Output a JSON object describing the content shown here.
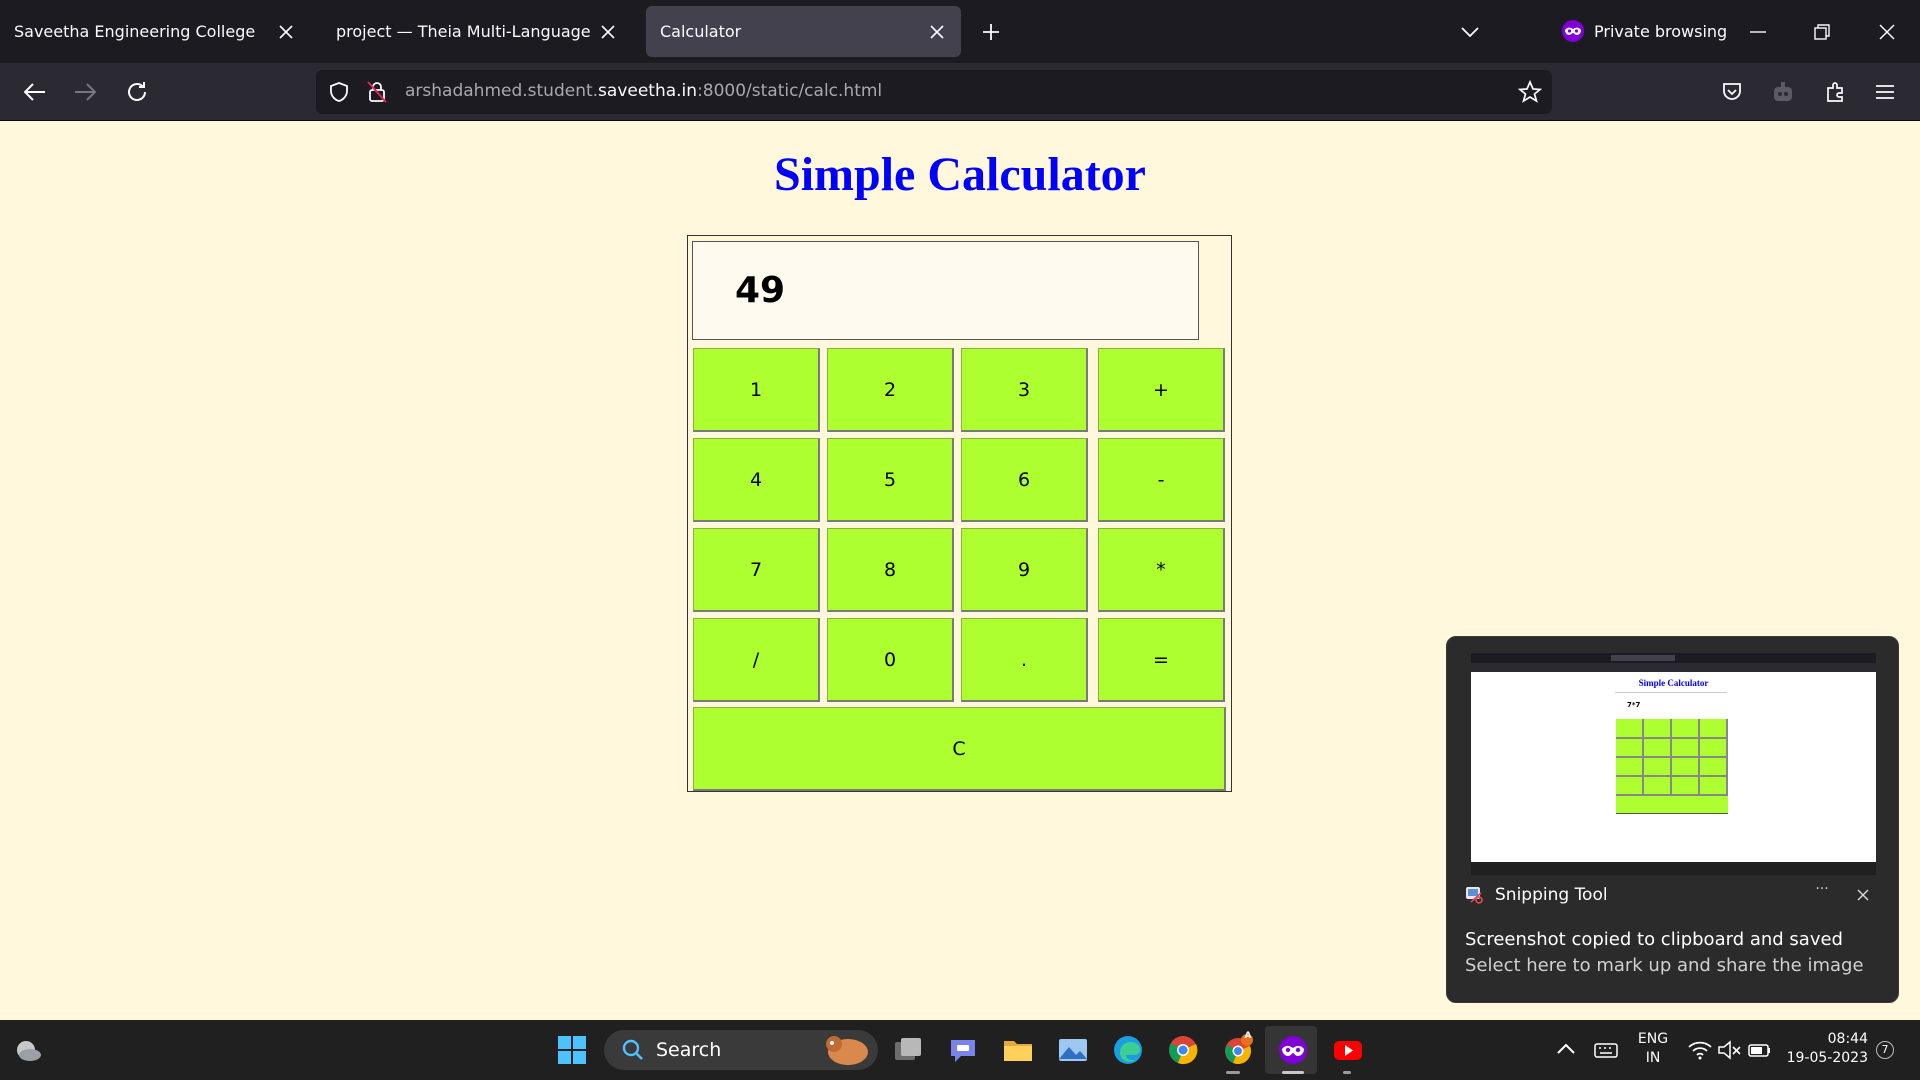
{
  "browser": {
    "tabs": [
      {
        "label": "Saveetha Engineering College",
        "active": false
      },
      {
        "label": "project — Theia Multi-Language Example",
        "active": false
      },
      {
        "label": "Calculator",
        "active": true
      }
    ],
    "private_label": "Private browsing",
    "url_prefix": "arshadahmed.student.",
    "url_host": "saveetha.in",
    "url_suffix": ":8000/static/calc.html"
  },
  "page": {
    "title": "Simple Calculator",
    "display_value": "49",
    "keys": [
      {
        "label": "1"
      },
      {
        "label": "2"
      },
      {
        "label": "3"
      },
      {
        "label": "+"
      },
      {
        "label": "4"
      },
      {
        "label": "5"
      },
      {
        "label": "6"
      },
      {
        "label": "-"
      },
      {
        "label": "7"
      },
      {
        "label": "8"
      },
      {
        "label": "9"
      },
      {
        "label": "*"
      },
      {
        "label": "/"
      },
      {
        "label": "0"
      },
      {
        "label": "."
      },
      {
        "label": "="
      }
    ],
    "clear_label": "C",
    "key_color": "#adff2f",
    "title_color": "#0000ff"
  },
  "toast": {
    "app_name": "Snipping Tool",
    "thumbnail_title": "Simple Calculator",
    "thumbnail_display": "7*7",
    "message": "Screenshot copied to clipboard and saved",
    "sub_message": "Select here to mark up and share the image",
    "more_label": "···"
  },
  "taskbar": {
    "search_label": "Search",
    "lang_line1": "ENG",
    "lang_line2": "IN",
    "time": "08:44",
    "date": "19-05-2023",
    "notification_count": "7",
    "chrome_badge": "A"
  }
}
